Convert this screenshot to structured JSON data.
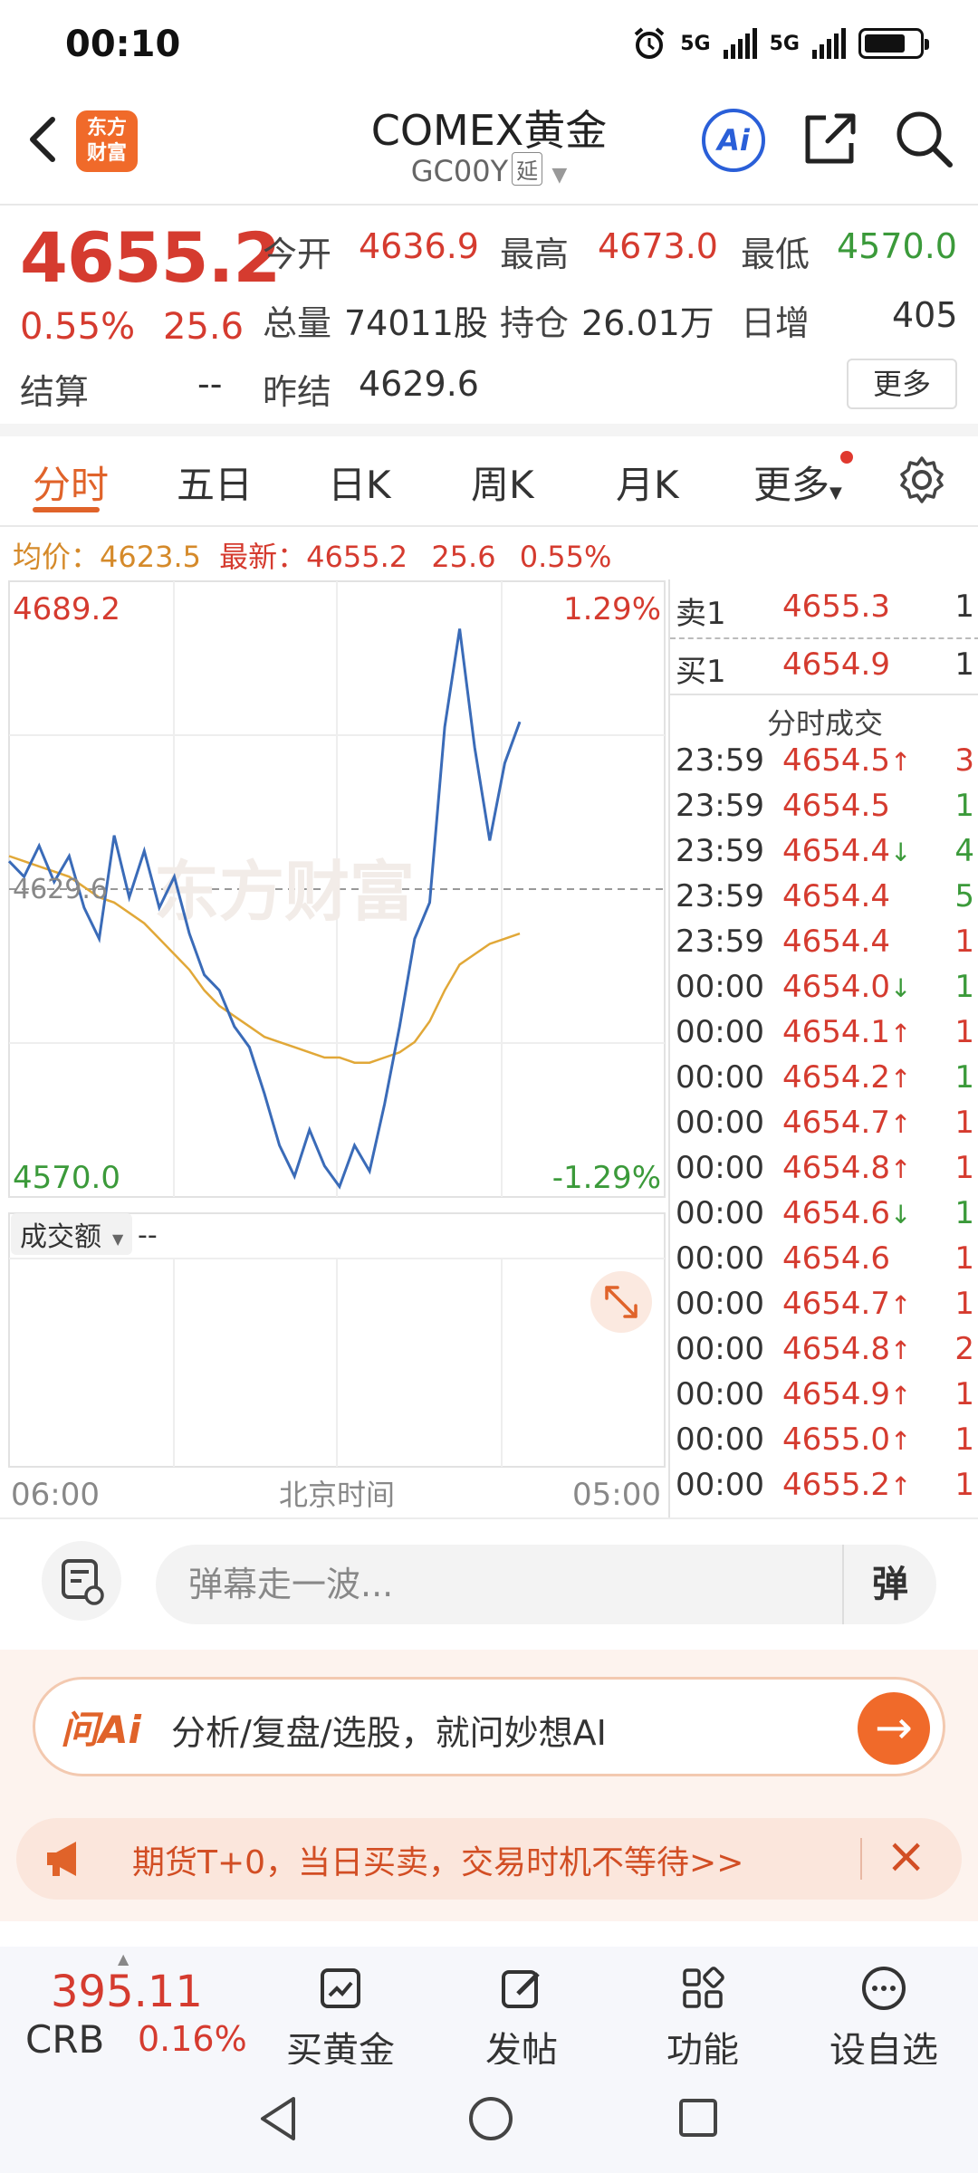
{
  "status": {
    "time": "00:10",
    "net1": "5G",
    "net2": "5G"
  },
  "header": {
    "title": "COMEX黄金",
    "code": "GC00Y",
    "delay_tag": "延",
    "logo_line1": "东方",
    "logo_line2": "财富",
    "ai_label": "Ai"
  },
  "quote": {
    "price": "4655.2",
    "pct": "0.55%",
    "change": "25.6",
    "open_label": "今开",
    "open": "4636.9",
    "high_label": "最高",
    "high": "4673.0",
    "low_label": "最低",
    "low": "4570.0",
    "volume_label": "总量",
    "volume": "74011股",
    "oi_label": "持仓",
    "oi": "26.01万",
    "daily_inc_label": "日增",
    "daily_inc": "405",
    "settle_label": "结算",
    "settle": "--",
    "prev_settle_label": "昨结",
    "prev_settle": "4629.6",
    "more_label": "更多"
  },
  "tabs": [
    "分时",
    "五日",
    "日K",
    "周K",
    "月K",
    "更多"
  ],
  "avg_row": {
    "avg_label": "均价：",
    "avg": "4623.5",
    "latest_label": "最新：",
    "latest": "4655.2",
    "chg": "25.6",
    "pct": "0.55%"
  },
  "chart": {
    "top_value": "4689.2",
    "top_pct": "1.29%",
    "mid_value": "4629.6",
    "bottom_value": "4570.0",
    "bottom_pct": "-1.29%",
    "watermark": "东方财富",
    "volume_label": "成交额",
    "volume_value": "--",
    "x_start": "06:00",
    "x_mid": "北京时间",
    "x_end": "05:00"
  },
  "chart_data": {
    "type": "line",
    "ylim": [
      4570.0,
      4689.2
    ],
    "reference": 4629.6,
    "series": [
      {
        "name": "最新",
        "values": [
          4635,
          4632,
          4638,
          4631,
          4636,
          4626,
          4620,
          4640,
          4628,
          4637,
          4626,
          4632,
          4621,
          4613,
          4610,
          4603,
          4599,
          4590,
          4580,
          4574,
          4583,
          4576,
          4572,
          4580,
          4575,
          4588,
          4603,
          4620,
          4627,
          4661,
          4680,
          4657,
          4639,
          4654,
          4662
        ]
      },
      {
        "name": "均价",
        "values": [
          4636,
          4635,
          4634,
          4633,
          4632,
          4630,
          4628,
          4627,
          4625,
          4623,
          4620,
          4617,
          4614,
          4610,
          4607,
          4605,
          4603,
          4601,
          4600,
          4599,
          4598,
          4597,
          4597,
          4596,
          4596,
          4597,
          4598,
          4600,
          4604,
          4610,
          4615,
          4617,
          4619,
          4620,
          4621
        ]
      }
    ]
  },
  "trades": {
    "ask_label": "卖1",
    "ask_price": "4655.3",
    "ask_vol": "1",
    "bid_label": "买1",
    "bid_price": "4654.9",
    "bid_vol": "1",
    "title": "分时成交",
    "rows": [
      {
        "time": "23:59",
        "price": "4654.5",
        "dir": "↑",
        "vol": "3",
        "color": "#d53b2f"
      },
      {
        "time": "23:59",
        "price": "4654.5",
        "dir": "",
        "vol": "1",
        "color": "#3b9a3a"
      },
      {
        "time": "23:59",
        "price": "4654.4",
        "dir": "↓",
        "vol": "4",
        "color": "#3b9a3a"
      },
      {
        "time": "23:59",
        "price": "4654.4",
        "dir": "",
        "vol": "5",
        "color": "#3b9a3a"
      },
      {
        "time": "23:59",
        "price": "4654.4",
        "dir": "",
        "vol": "1",
        "color": "#d53b2f"
      },
      {
        "time": "00:00",
        "price": "4654.0",
        "dir": "↓",
        "vol": "1",
        "color": "#3b9a3a"
      },
      {
        "time": "00:00",
        "price": "4654.1",
        "dir": "↑",
        "vol": "1",
        "color": "#d53b2f"
      },
      {
        "time": "00:00",
        "price": "4654.2",
        "dir": "↑",
        "vol": "1",
        "color": "#3b9a3a"
      },
      {
        "time": "00:00",
        "price": "4654.7",
        "dir": "↑",
        "vol": "1",
        "color": "#d53b2f"
      },
      {
        "time": "00:00",
        "price": "4654.8",
        "dir": "↑",
        "vol": "1",
        "color": "#d53b2f"
      },
      {
        "time": "00:00",
        "price": "4654.6",
        "dir": "↓",
        "vol": "1",
        "color": "#3b9a3a"
      },
      {
        "time": "00:00",
        "price": "4654.6",
        "dir": "",
        "vol": "1",
        "color": "#d53b2f"
      },
      {
        "time": "00:00",
        "price": "4654.7",
        "dir": "↑",
        "vol": "1",
        "color": "#d53b2f"
      },
      {
        "time": "00:00",
        "price": "4654.8",
        "dir": "↑",
        "vol": "2",
        "color": "#d53b2f"
      },
      {
        "time": "00:00",
        "price": "4654.9",
        "dir": "↑",
        "vol": "1",
        "color": "#d53b2f"
      },
      {
        "time": "00:00",
        "price": "4655.0",
        "dir": "↑",
        "vol": "1",
        "color": "#d53b2f"
      },
      {
        "time": "00:00",
        "price": "4655.2",
        "dir": "↑",
        "vol": "1",
        "color": "#d53b2f"
      }
    ]
  },
  "comment": {
    "placeholder": "弹幕走一波...",
    "danmu_btn": "弹"
  },
  "ai_bar": {
    "brand": "问Ai",
    "text": "分析/复盘/选股，就问妙想AI"
  },
  "promo": {
    "text": "期货T+0，当日买卖，交易时机不等待>>"
  },
  "bottom_nav": {
    "crb_price": "395.11",
    "crb_name": "CRB",
    "crb_pct": "0.16%",
    "items": [
      "买黄金",
      "发帖",
      "功能",
      "设自选"
    ]
  }
}
